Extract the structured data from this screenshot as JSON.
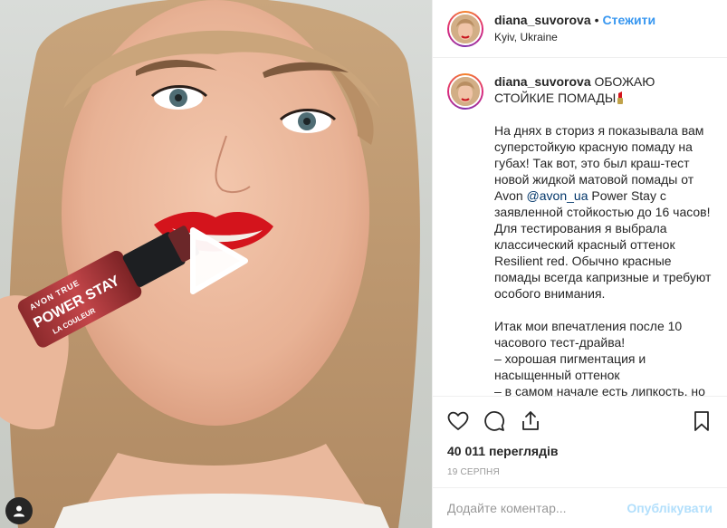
{
  "post": {
    "username": "diana_suvorova",
    "dot": "•",
    "follow_label": "Стежити",
    "location": "Kyiv, Ukraine"
  },
  "caption": {
    "username": "diana_suvorova",
    "title": "ОБОЖАЮ СТОЙКИЕ ПОМАДЫ",
    "title_emoji": "lipstick-emoji",
    "para1_before": "На днях в сториз я показывала вам суперстойкую красную помаду на губах! Так вот, это был краш-тест новой жидкой матовой помады от Avon ",
    "mention": "@avon_ua",
    "para1_after": " Power Stay с заявленной стойкостью до 16 часов! Для тестирования я выбрала классический красный оттенок Resilient red. Обычно красные помады всегда капризные и требуют особого внимания.",
    "para2": "Итак мои впечатления после 10 часового тест-драйва!\n– хорошая пигментация и насыщенный оттенок\n– в самом начале есть липкость, но"
  },
  "media": {
    "product_text_1": "AVON TRUE",
    "product_text_2": "POWER STAY",
    "product_text_3": "LA COULEUR",
    "play_icon": "play-icon"
  },
  "actions": {
    "like_icon": "heart-icon",
    "comment_icon": "comment-icon",
    "share_icon": "share-icon",
    "save_icon": "bookmark-icon",
    "views": "40 011 переглядів",
    "date": "19 серпня"
  },
  "comment": {
    "placeholder": "Додайте коментар...",
    "publish_label": "Опублікувати"
  },
  "colors": {
    "accent": "#3897f0",
    "publish_disabled": "#b2dffc",
    "mention": "#003569",
    "lip_red": "#d4141c"
  }
}
